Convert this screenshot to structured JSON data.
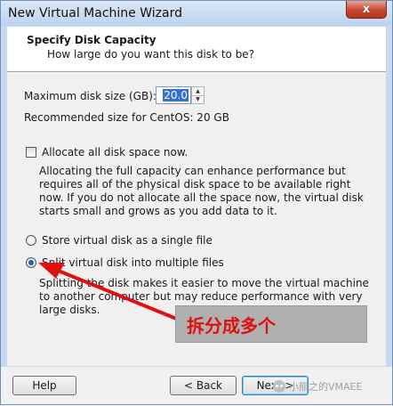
{
  "window": {
    "title": "New Virtual Machine Wizard",
    "close_glyph": "x"
  },
  "header": {
    "title": "Specify Disk Capacity",
    "subtitle": "How large do you want this disk to be?"
  },
  "disk": {
    "size_label": "Maximum disk size (GB):",
    "size_value": "20.0",
    "recommended": "Recommended size for CentOS: 20 GB"
  },
  "allocate": {
    "label": "Allocate all disk space now.",
    "checked": false,
    "description": "Allocating the full capacity can enhance performance but requires all of the physical disk space to be available right now. If you do not allocate all the space now, the virtual disk starts small and grows as you add data to it."
  },
  "storage_options": [
    {
      "label": "Store virtual disk as a single file",
      "selected": false
    },
    {
      "label": "Split virtual disk into multiple files",
      "selected": true
    }
  ],
  "split_description": "Splitting the disk makes it easier to move the virtual machine to another computer but may reduce performance with very large disks.",
  "annotation": {
    "text": "拆分成多个",
    "color": "#e01010"
  },
  "buttons": {
    "help": "Help",
    "back": "< Back",
    "next": "Next >"
  },
  "watermark": "小熊之的VMAEE"
}
